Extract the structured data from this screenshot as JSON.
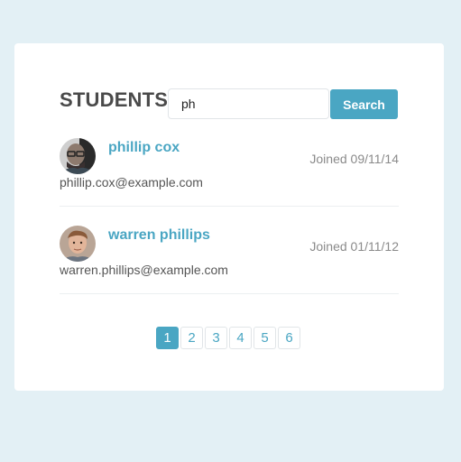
{
  "header": {
    "title": "STUDENTS"
  },
  "search": {
    "value": "ph",
    "button_label": "Search"
  },
  "students": [
    {
      "name": "phillip cox",
      "email": "phillip.cox@example.com",
      "joined": "Joined 09/11/14"
    },
    {
      "name": "warren phillips",
      "email": "warren.phillips@example.com",
      "joined": "Joined 01/11/12"
    }
  ],
  "pagination": {
    "pages": [
      "1",
      "2",
      "3",
      "4",
      "5",
      "6"
    ],
    "current": "1"
  },
  "colors": {
    "background": "#e3f0f5",
    "accent": "#4aa6c3",
    "card": "#ffffff"
  }
}
